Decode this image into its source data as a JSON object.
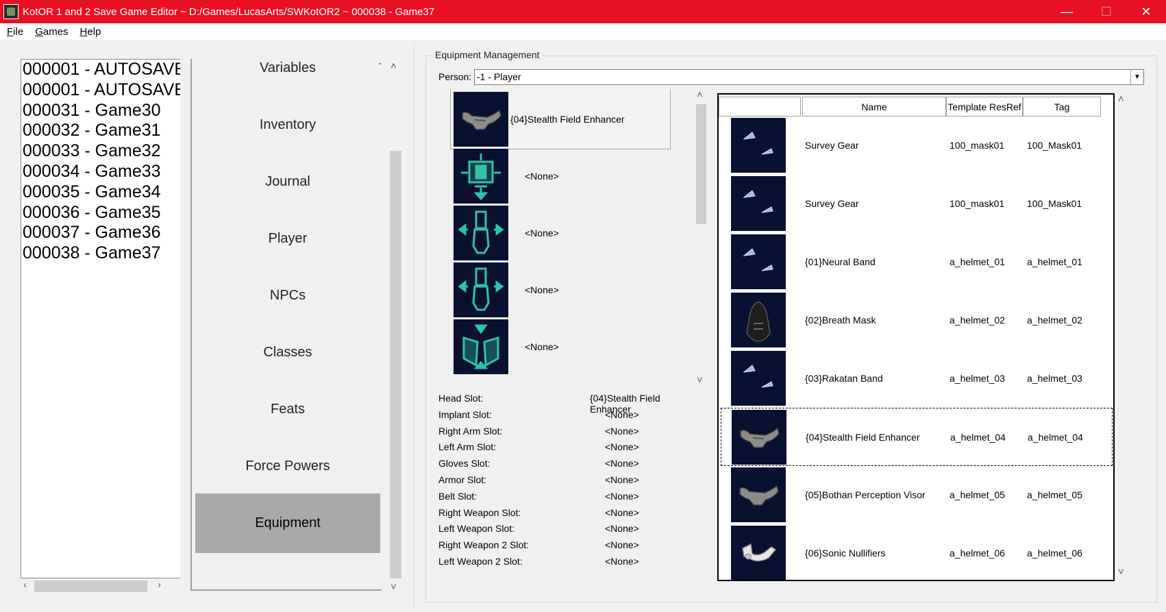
{
  "window": {
    "title": "KotOR 1 and 2 Save Game Editor ~ D:/Games/LucasArts/SWKotOR2 ~ 000038 - Game37"
  },
  "menu": [
    {
      "key": "F",
      "rest": "ile"
    },
    {
      "key": "G",
      "rest": "ames"
    },
    {
      "key": "H",
      "rest": "elp"
    }
  ],
  "saves": [
    "000001 - AUTOSAVE",
    "000001 - AUTOSAVE",
    "000031 - Game30",
    "000032 - Game31",
    "000033 - Game32",
    "000034 - Game33",
    "000035 - Game34",
    "000036 - Game35",
    "000037 - Game36",
    "000038 - Game37"
  ],
  "nav": {
    "items": [
      "Variables",
      "Inventory",
      "Journal",
      "Player",
      "NPCs",
      "Classes",
      "Feats",
      "Force Powers",
      "Equipment"
    ],
    "active": "Equipment"
  },
  "equipment": {
    "group_title": "Equipment Management",
    "person_label": "Person:",
    "person_value": "-1 - Player",
    "slot_previews": [
      {
        "label": "{04}Stealth Field Enhancer",
        "icon": "stealth-enhancer-icon",
        "selected": true
      },
      {
        "label": "<None>",
        "icon": "implant-slot-icon"
      },
      {
        "label": "<None>",
        "icon": "right-arm-slot-icon"
      },
      {
        "label": "<None>",
        "icon": "left-arm-slot-icon"
      },
      {
        "label": "<None>",
        "icon": "gloves-slot-icon"
      }
    ],
    "slots": [
      {
        "name": "Head Slot:",
        "value": "{04}Stealth Field Enhancer"
      },
      {
        "name": "Implant Slot:",
        "value": "<None>"
      },
      {
        "name": "Right Arm Slot:",
        "value": "<None>"
      },
      {
        "name": "Left Arm Slot:",
        "value": "<None>"
      },
      {
        "name": "Gloves Slot:",
        "value": "<None>"
      },
      {
        "name": "Armor Slot:",
        "value": "<None>"
      },
      {
        "name": "Belt Slot:",
        "value": "<None>"
      },
      {
        "name": "Right Weapon Slot:",
        "value": "<None>"
      },
      {
        "name": "Left Weapon Slot:",
        "value": "<None>"
      },
      {
        "name": "Right Weapon 2 Slot:",
        "value": "<None>"
      },
      {
        "name": "Left Weapon 2 Slot:",
        "value": "<None>"
      }
    ],
    "columns": [
      "Name",
      "Template ResRef",
      "Tag"
    ],
    "items": [
      {
        "name": "Survey Gear",
        "resref": "100_mask01",
        "tag": "100_Mask01",
        "icon": "survey-gear-icon"
      },
      {
        "name": "Survey Gear",
        "resref": "100_mask01",
        "tag": "100_Mask01",
        "icon": "survey-gear-icon"
      },
      {
        "name": "{01}Neural Band",
        "resref": "a_helmet_01",
        "tag": "a_helmet_01",
        "icon": "neural-band-icon"
      },
      {
        "name": "{02}Breath Mask",
        "resref": "a_helmet_02",
        "tag": "a_helmet_02",
        "icon": "breath-mask-icon"
      },
      {
        "name": "{03}Rakatan Band",
        "resref": "a_helmet_03",
        "tag": "a_helmet_03",
        "icon": "rakatan-band-icon"
      },
      {
        "name": "{04}Stealth Field Enhancer",
        "resref": "a_helmet_04",
        "tag": "a_helmet_04",
        "icon": "stealth-enhancer-icon",
        "focused": true
      },
      {
        "name": "{05}Bothan Perception Visor",
        "resref": "a_helmet_05",
        "tag": "a_helmet_05",
        "icon": "bothan-visor-icon"
      },
      {
        "name": "{06}Sonic Nullifiers",
        "resref": "a_helmet_06",
        "tag": "a_helmet_06",
        "icon": "sonic-nullifiers-icon"
      }
    ]
  },
  "colors": {
    "titlebar": "#e81123",
    "nav_active": "#a9a9a9",
    "item_bg": "#0a1030",
    "slot_icon": "#2ec4a6"
  }
}
